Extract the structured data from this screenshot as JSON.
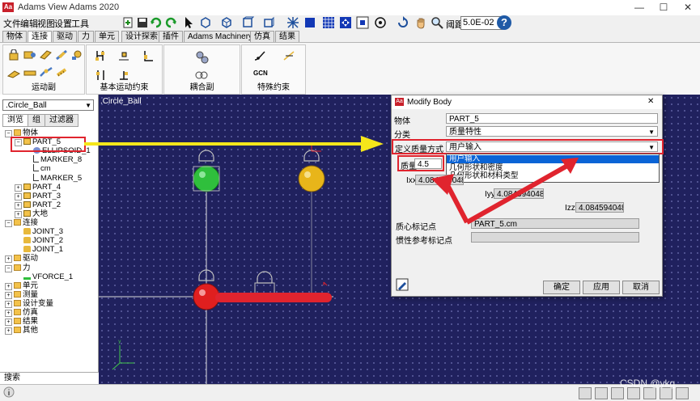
{
  "window": {
    "title": "Adams View Adams 2020",
    "app_icon_text": "Aa",
    "minimize": "—",
    "maximize": "☐",
    "close": "✕"
  },
  "menu": [
    "文件",
    "编辑",
    "视图",
    "设置",
    "工具"
  ],
  "toolbar": {
    "zoom_label": "阈距",
    "zoom_value": "5.0E-02",
    "help": "?"
  },
  "ribbon_tabs": [
    "物体",
    "连接",
    "驱动",
    "力",
    "单元",
    "设计探索",
    "插件",
    "Adams Machinery",
    "仿真",
    "结果"
  ],
  "ribbon_groups": [
    {
      "label": "运动副"
    },
    {
      "label": "基本运动约束"
    },
    {
      "label": "耦合副"
    },
    {
      "label": "特殊约束",
      "icon_text": "GCN"
    }
  ],
  "left_panel": {
    "model_combo": ".Circle_Ball",
    "tabs": [
      "浏览",
      "组",
      "过滤器"
    ],
    "tree": [
      {
        "label": "物体",
        "indent": 0,
        "icon": "folder",
        "expander": "−"
      },
      {
        "label": "PART_5",
        "indent": 1,
        "icon": "part",
        "expander": "−",
        "highlight": true
      },
      {
        "label": "ELLIPSOID_1",
        "indent": 2,
        "icon": "ellipsoid"
      },
      {
        "label": "MARKER_8",
        "indent": 2,
        "icon": "marker"
      },
      {
        "label": "cm",
        "indent": 2,
        "icon": "marker"
      },
      {
        "label": "MARKER_5",
        "indent": 2,
        "icon": "marker"
      },
      {
        "label": "PART_4",
        "indent": 1,
        "icon": "part",
        "expander": "+"
      },
      {
        "label": "PART_3",
        "indent": 1,
        "icon": "part",
        "expander": "+"
      },
      {
        "label": "PART_2",
        "indent": 1,
        "icon": "part",
        "expander": "+"
      },
      {
        "label": "大地",
        "indent": 1,
        "icon": "ground",
        "expander": "+"
      },
      {
        "label": "连接",
        "indent": 0,
        "icon": "folder",
        "expander": "−"
      },
      {
        "label": "JOINT_3",
        "indent": 1,
        "icon": "lock"
      },
      {
        "label": "JOINT_2",
        "indent": 1,
        "icon": "lock"
      },
      {
        "label": "JOINT_1",
        "indent": 1,
        "icon": "lock"
      },
      {
        "label": "驱动",
        "indent": 0,
        "icon": "folder",
        "expander": "+"
      },
      {
        "label": "力",
        "indent": 0,
        "icon": "folder",
        "expander": "−"
      },
      {
        "label": "VFORCE_1",
        "indent": 1,
        "icon": "force"
      },
      {
        "label": "单元",
        "indent": 0,
        "icon": "folder",
        "expander": "+"
      },
      {
        "label": "测量",
        "indent": 0,
        "icon": "folder",
        "expander": "+"
      },
      {
        "label": "设计变量",
        "indent": 0,
        "icon": "folder",
        "expander": "+"
      },
      {
        "label": "仿真",
        "indent": 0,
        "icon": "folder",
        "expander": "+"
      },
      {
        "label": "结果",
        "indent": 0,
        "icon": "folder",
        "expander": "+"
      },
      {
        "label": "其他",
        "indent": 0,
        "icon": "folder",
        "expander": "+"
      }
    ],
    "search_label": "搜索"
  },
  "viewport": {
    "title": ".Circle_Ball"
  },
  "dialog": {
    "title": "Modify Body",
    "icon_text": "Aa",
    "close": "✕",
    "body_label": "物体",
    "body_value": "PART_5",
    "category_label": "分类",
    "category_value": "质量特性",
    "mass_method_label": "定义质量方式",
    "mass_method_value": "用户输入",
    "mass_method_options": [
      "用户输入",
      "几何形状和密度",
      "几何形状和材料类型"
    ],
    "mass_label": "质量",
    "mass_value": "4.5",
    "ixx_label": "Ixx",
    "ixx_value": "4.0845940484E",
    "iyy_label": "Iyy",
    "iyy_value": "4.0845940484E",
    "izz_label": "Izz",
    "izz_value": "4.0845940484E",
    "cm_marker_label": "质心标记点",
    "cm_marker_value": "PART_5.cm",
    "inertia_marker_label": "惯性参考标记点",
    "inertia_marker_value": "",
    "ok": "确定",
    "apply": "应用",
    "cancel": "取消"
  },
  "status": {
    "watermark": "CSDN @ykg"
  },
  "colors": {
    "viewport_bg": "#20215e",
    "annotation_red": "#e0242e",
    "annotation_yellow": "#f5e61b",
    "green_ball": "#2fbf3c",
    "yellow_ball": "#e8b51a",
    "red_ball": "#e01f1f"
  }
}
